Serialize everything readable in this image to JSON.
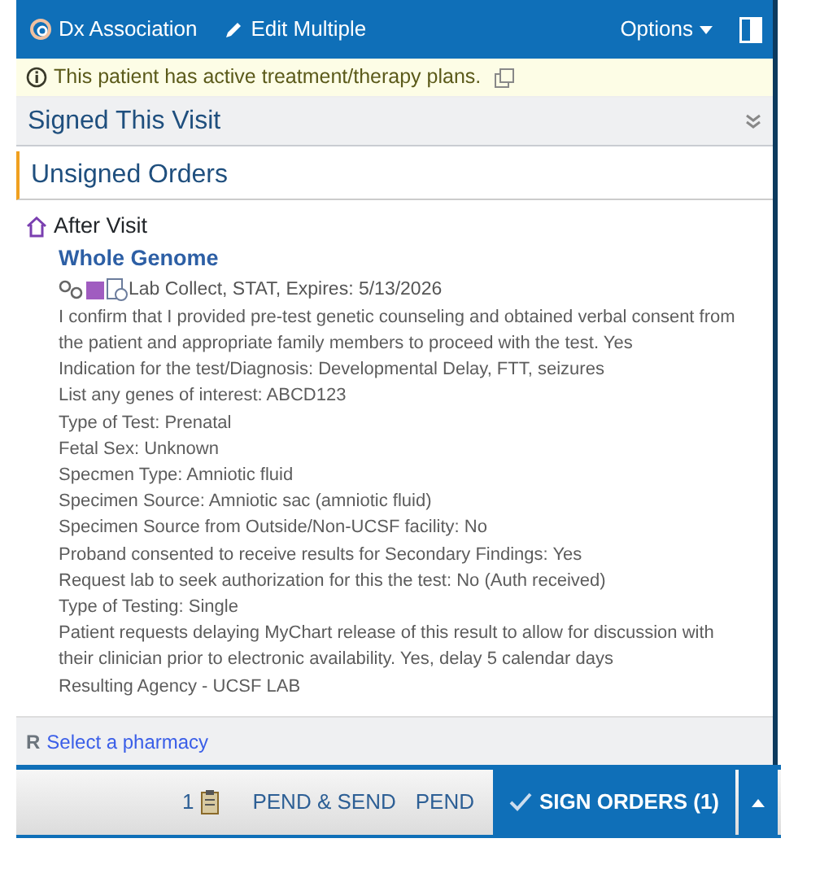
{
  "toolbar": {
    "buttons": [
      {
        "kind": "dx",
        "label": "Dx Association"
      },
      {
        "kind": "edit",
        "label": "Edit Multiple"
      }
    ],
    "options": "Options"
  },
  "banner": {
    "text": "This patient has active treatment/therapy plans."
  },
  "sections": [
    {
      "title": "Signed This Visit",
      "expanded": false,
      "kind": "collapsible"
    },
    {
      "title": "Unsigned Orders",
      "kind": "active"
    }
  ],
  "group": {
    "title": "After Visit"
  },
  "order": {
    "name": "Whole Genome",
    "summary": "Lab Collect, STAT, Expires: 5/13/2026",
    "details": [
      "I confirm that I provided pre-test genetic counseling and obtained verbal consent from the patient and appropriate family members to proceed with the test. Yes",
      "Indication for the test/Diagnosis: Developmental Delay, FTT, seizures",
      "List any genes of interest: ABCD123",
      "Type of Test: Prenatal",
      "Fetal Sex: Unknown",
      "Specmen Type: Amniotic fluid",
      "Specimen Source: Amniotic sac (amniotic fluid)",
      "Specimen Source from Outside/Non-UCSF facility: No",
      "Proband consented to receive results for Secondary Findings: Yes",
      "Request lab to seek authorization for this the test: No (Auth received)",
      "Type of Testing: Single",
      "Patient requests delaying MyChart release of this result to allow for discussion with their clinician prior to electronic availability. Yes, delay 5 calendar days",
      "Resulting Agency - UCSF LAB"
    ]
  },
  "pharmacy": {
    "symbol": "R",
    "link": "Select a pharmacy"
  },
  "footer": {
    "count": "1",
    "pend_send": "PEND & SEND",
    "pend": "PEND",
    "sign": "SIGN ORDERS (1)"
  }
}
